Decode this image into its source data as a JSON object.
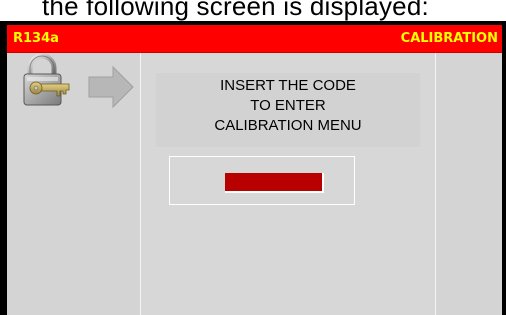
{
  "document": {
    "caption": "the following screen is displayed:"
  },
  "screen": {
    "title_left": "R134a",
    "title_right": "CALIBRATION",
    "message_lines": [
      "INSERT THE CODE",
      "TO ENTER",
      "CALIBRATION MENU"
    ],
    "code_input_value": ""
  },
  "icons": {
    "lock": "padlock-with-key-icon",
    "arrow": "right-arrow-icon"
  },
  "colors": {
    "title_bar_bg": "#ff0000",
    "title_text": "#ffff00",
    "panel_bg": "#d4d4d4",
    "screen_bg": "#000000",
    "code_field_bg": "#b80000"
  }
}
